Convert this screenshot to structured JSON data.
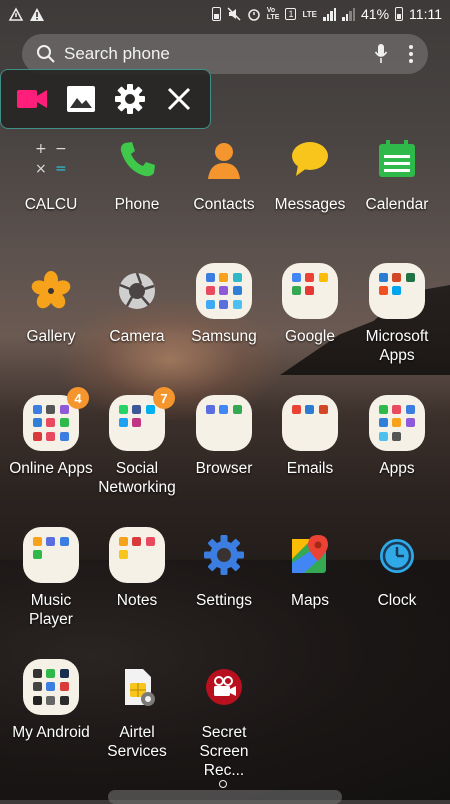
{
  "status_bar": {
    "battery": "41%",
    "time": "11:11",
    "volte_label": "Vo\nLTE",
    "lte_label": "LTE",
    "sim_label": "1"
  },
  "search": {
    "placeholder": "Search phone"
  },
  "float_toolbar": {
    "items": [
      "record-video",
      "gallery",
      "settings",
      "close"
    ]
  },
  "apps": [
    {
      "label": "CALCU",
      "icon": "calculator-icon"
    },
    {
      "label": "Phone",
      "icon": "phone-icon"
    },
    {
      "label": "Contacts",
      "icon": "contacts-icon"
    },
    {
      "label": "Messages",
      "icon": "messages-icon"
    },
    {
      "label": "Calendar",
      "icon": "calendar-icon"
    },
    {
      "label": "Gallery",
      "icon": "gallery-icon"
    },
    {
      "label": "Camera",
      "icon": "camera-icon"
    },
    {
      "label": "Samsung",
      "icon": "folder-icon"
    },
    {
      "label": "Google",
      "icon": "folder-icon"
    },
    {
      "label": "Microsoft\nApps",
      "icon": "folder-icon"
    },
    {
      "label": "Online Apps",
      "icon": "folder-icon",
      "badge": "4"
    },
    {
      "label": "Social\nNetworking",
      "icon": "folder-icon",
      "badge": "7"
    },
    {
      "label": "Browser",
      "icon": "folder-icon"
    },
    {
      "label": "Emails",
      "icon": "folder-icon"
    },
    {
      "label": "Apps",
      "icon": "folder-icon"
    },
    {
      "label": "Music\nPlayer",
      "icon": "folder-icon"
    },
    {
      "label": "Notes",
      "icon": "folder-icon"
    },
    {
      "label": "Settings",
      "icon": "settings-icon"
    },
    {
      "label": "Maps",
      "icon": "maps-icon"
    },
    {
      "label": "Clock",
      "icon": "clock-icon"
    },
    {
      "label": "My Android",
      "icon": "folder-icon"
    },
    {
      "label": "Airtel\nServices",
      "icon": "sim-icon"
    },
    {
      "label": "Secret\nScreen Rec...",
      "icon": "screen-recorder-icon"
    }
  ],
  "colors": {
    "toolbar_border": "#3f8f88",
    "record_pink": "#ff1e7a",
    "badge_orange": "#f5952d",
    "folder_bg": "#f5f1e6"
  }
}
